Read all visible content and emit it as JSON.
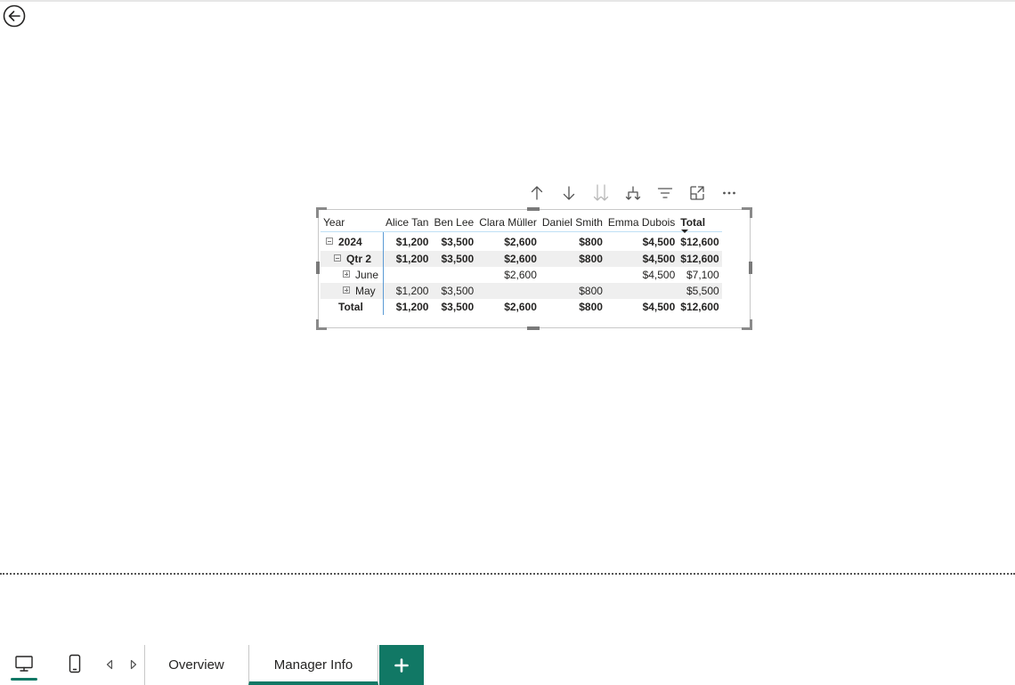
{
  "icons": {
    "back": "back-arrow-circle-icon",
    "toolbar": [
      "arrow-up-icon",
      "arrow-down-icon",
      "double-arrow-down-icon",
      "expand-hierarchy-icon",
      "filter-icon",
      "focus-mode-icon",
      "more-options-icon"
    ],
    "desktop_view": "desktop-icon",
    "mobile_view": "phone-icon",
    "prev_page": "triangle-left-icon",
    "next_page": "triangle-right-icon",
    "add_page": "plus-icon"
  },
  "colors": {
    "accent": "#117865",
    "row_header_border": "#5b9bd5",
    "header_underline": "#bfe0f5",
    "row_shade": "#efefef"
  },
  "matrix": {
    "row_header_label": "Year",
    "columns": [
      "Alice Tan",
      "Ben Lee",
      "Clara Müller",
      "Daniel Smith",
      "Emma Dubois",
      "Total"
    ],
    "sorted_column": "Total",
    "rows": [
      {
        "label": "2024",
        "level": 0,
        "expander": "minus",
        "bold": true,
        "shaded": false,
        "values": [
          "$1,200",
          "$3,500",
          "$2,600",
          "$800",
          "$4,500",
          "$12,600"
        ]
      },
      {
        "label": "Qtr 2",
        "level": 1,
        "expander": "minus",
        "bold": true,
        "shaded": true,
        "values": [
          "$1,200",
          "$3,500",
          "$2,600",
          "$800",
          "$4,500",
          "$12,600"
        ]
      },
      {
        "label": "June",
        "level": 2,
        "expander": "plus",
        "bold": false,
        "shaded": false,
        "values": [
          "",
          "",
          "$2,600",
          "",
          "$4,500",
          "$7,100"
        ]
      },
      {
        "label": "May",
        "level": 2,
        "expander": "plus",
        "bold": false,
        "shaded": true,
        "values": [
          "$1,200",
          "$3,500",
          "",
          "$800",
          "",
          "$5,500"
        ]
      },
      {
        "label": "Total",
        "level": 1,
        "expander": "none",
        "bold": true,
        "shaded": false,
        "values": [
          "$1,200",
          "$3,500",
          "$2,600",
          "$800",
          "$4,500",
          "$12,600"
        ]
      }
    ]
  },
  "tabs": {
    "pages": [
      {
        "label": "Overview",
        "active": false
      },
      {
        "label": "Manager Info",
        "active": true
      }
    ]
  }
}
